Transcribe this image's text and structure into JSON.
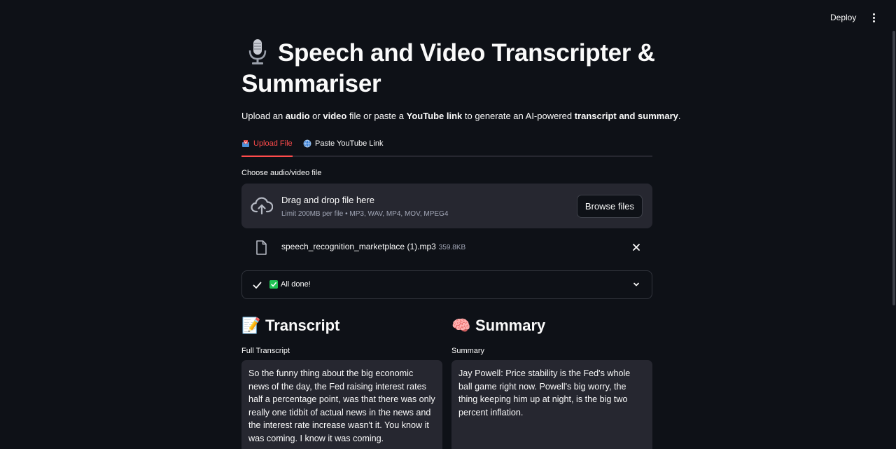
{
  "header": {
    "deploy_label": "Deploy"
  },
  "title": {
    "text": "Speech and Video Transcripter & Summariser"
  },
  "subtitle": {
    "p1": "Upload an ",
    "b1": "audio",
    "p2": " or ",
    "b2": "video",
    "p3": " file or paste a ",
    "b3": "YouTube link",
    "p4": " to generate an AI-powered ",
    "b4": "transcript and summary",
    "p5": "."
  },
  "tabs": [
    {
      "label": "Upload File",
      "active": true
    },
    {
      "label": "Paste YouTube Link",
      "active": false
    }
  ],
  "uploader": {
    "label": "Choose audio/video file",
    "drop_title": "Drag and drop file here",
    "limit": "Limit 200MB per file • MP3, WAV, MP4, MOV, MPEG4",
    "browse_label": "Browse files"
  },
  "file": {
    "name": "speech_recognition_marketplace (1).mp3",
    "size": "359.8KB"
  },
  "status": {
    "text": "All done!"
  },
  "transcript": {
    "emoji": "📝",
    "heading": "Transcript",
    "label": "Full Transcript",
    "text": " So the funny thing about the big economic news of the day, the Fed raising interest rates half a percentage point, was that there was only really one tidbit of actual news in the news and the interest rate increase wasn't it. You know it was coming. I know it was coming."
  },
  "summary": {
    "emoji": "🧠",
    "heading": "Summary",
    "label": "Summary",
    "text": "Jay Powell: Price stability is the Fed's whole ball game right now. Powell's big worry, the thing keeping him up at night, is the big two percent inflation."
  },
  "colors": {
    "accent": "#ff4b4b",
    "background": "#0e1117",
    "surface": "#262730",
    "success": "#21c354"
  }
}
